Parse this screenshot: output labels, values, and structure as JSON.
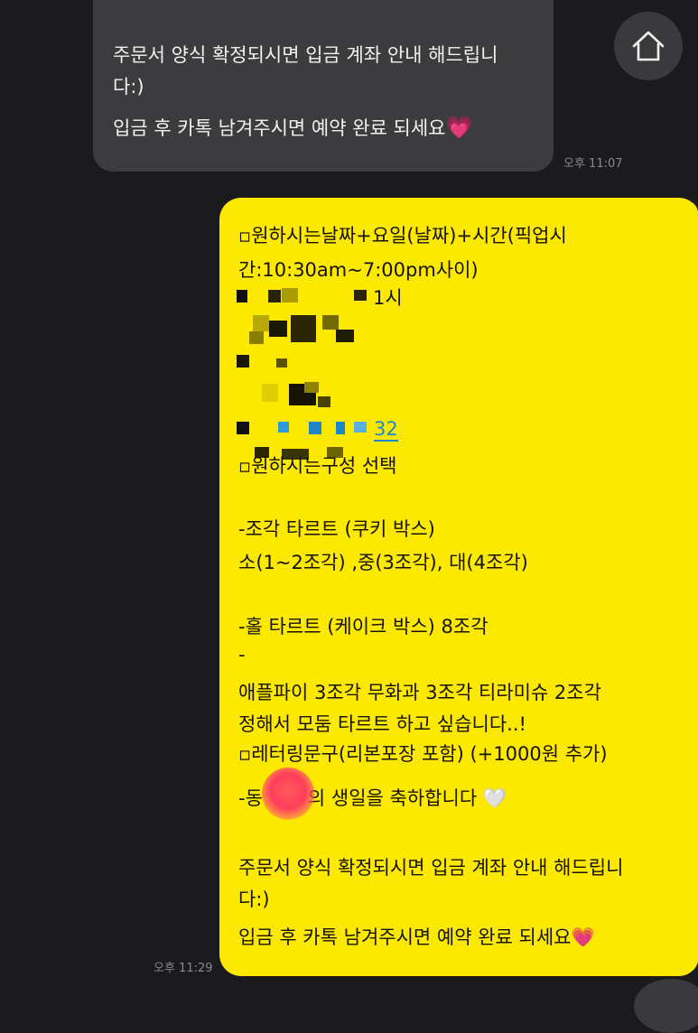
{
  "incoming": {
    "line1": "주문서 양식 확정되시면 입금 계좌 안내 해드립니",
    "line2": "다:)",
    "line3": "입금 후 카톡 남겨주시면 예약 완료 되세요",
    "heart": "💗",
    "time": "오후 11:07"
  },
  "outgoing": {
    "l1": "▫원하시는날짜+요일(날짜)+시간(픽업시",
    "l2": "간:10:30am~7:00pm사이)",
    "l3": "1시",
    "l4_link": "32",
    "l5": "▫원하시는구성 선택",
    "l6": "-조각 타르트 (쿠키 박스)",
    "l7": " 소(1~2조각) ,중(3조각), 대(4조각)",
    "l8": "-홀 타르트 (케이크 박스)  8조각",
    "l9": "-",
    "l10": "애플파이 3조각 무화과 3조각 티라미슈 2조각",
    "l11": "정해서 모둠 타르트 하고 싶습니다..!",
    "l12": "▫레터링문구(리본포장 포함) (+1000원 추가)",
    "l13a": "-동",
    "l13b": "의 생일을 축하합니다",
    "l13_heart": "🤍",
    "l14": "주문서 양식 확정되시면 입금 계좌 안내 해드립니",
    "l15": "다:)",
    "l16": "입금 후 카톡 남겨주시면 예약 완료 되세요",
    "heart": "💗",
    "time": "오후 11:29"
  },
  "icons": {
    "home": "home-icon"
  },
  "colors": {
    "background": "#1b1b1d",
    "incoming_bubble": "#3c3c3e",
    "outgoing_bubble": "#fde900",
    "link": "#1d86c8"
  }
}
